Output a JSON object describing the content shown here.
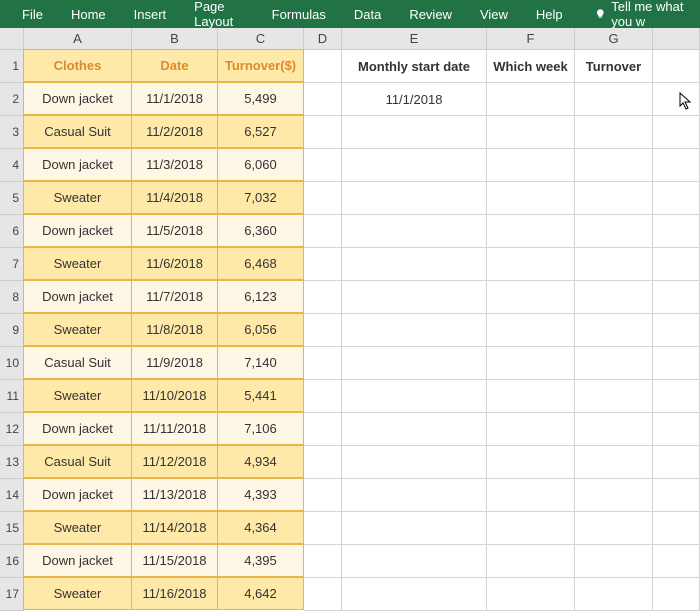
{
  "ribbon": {
    "tabs": [
      "File",
      "Home",
      "Insert",
      "Page Layout",
      "Formulas",
      "Data",
      "Review",
      "View",
      "Help"
    ],
    "tellMe": "Tell me what you w"
  },
  "columns": [
    "A",
    "B",
    "C",
    "D",
    "E",
    "F",
    "G"
  ],
  "rows": [
    "1",
    "2",
    "3",
    "4",
    "5",
    "6",
    "7",
    "8",
    "9",
    "10",
    "11",
    "12",
    "13",
    "14",
    "15",
    "16",
    "17"
  ],
  "headers": {
    "A": "Clothes",
    "B": "Date",
    "C": "Turnover($)",
    "E": "Monthly start date",
    "F": "Which week",
    "G": "Turnover"
  },
  "e2": "11/1/2018",
  "data": [
    {
      "a": "Down jacket",
      "b": "11/1/2018",
      "c": "5,499"
    },
    {
      "a": "Casual Suit",
      "b": "11/2/2018",
      "c": "6,527"
    },
    {
      "a": "Down jacket",
      "b": "11/3/2018",
      "c": "6,060"
    },
    {
      "a": "Sweater",
      "b": "11/4/2018",
      "c": "7,032"
    },
    {
      "a": "Down jacket",
      "b": "11/5/2018",
      "c": "6,360"
    },
    {
      "a": "Sweater",
      "b": "11/6/2018",
      "c": "6,468"
    },
    {
      "a": "Down jacket",
      "b": "11/7/2018",
      "c": "6,123"
    },
    {
      "a": "Sweater",
      "b": "11/8/2018",
      "c": "6,056"
    },
    {
      "a": "Casual Suit",
      "b": "11/9/2018",
      "c": "7,140"
    },
    {
      "a": "Sweater",
      "b": "11/10/2018",
      "c": "5,441"
    },
    {
      "a": "Down jacket",
      "b": "11/11/2018",
      "c": "7,106"
    },
    {
      "a": "Casual Suit",
      "b": "11/12/2018",
      "c": "4,934"
    },
    {
      "a": "Down jacket",
      "b": "11/13/2018",
      "c": "4,393"
    },
    {
      "a": "Sweater",
      "b": "11/14/2018",
      "c": "4,364"
    },
    {
      "a": "Down jacket",
      "b": "11/15/2018",
      "c": "4,395"
    },
    {
      "a": "Sweater",
      "b": "11/16/2018",
      "c": "4,642"
    }
  ]
}
